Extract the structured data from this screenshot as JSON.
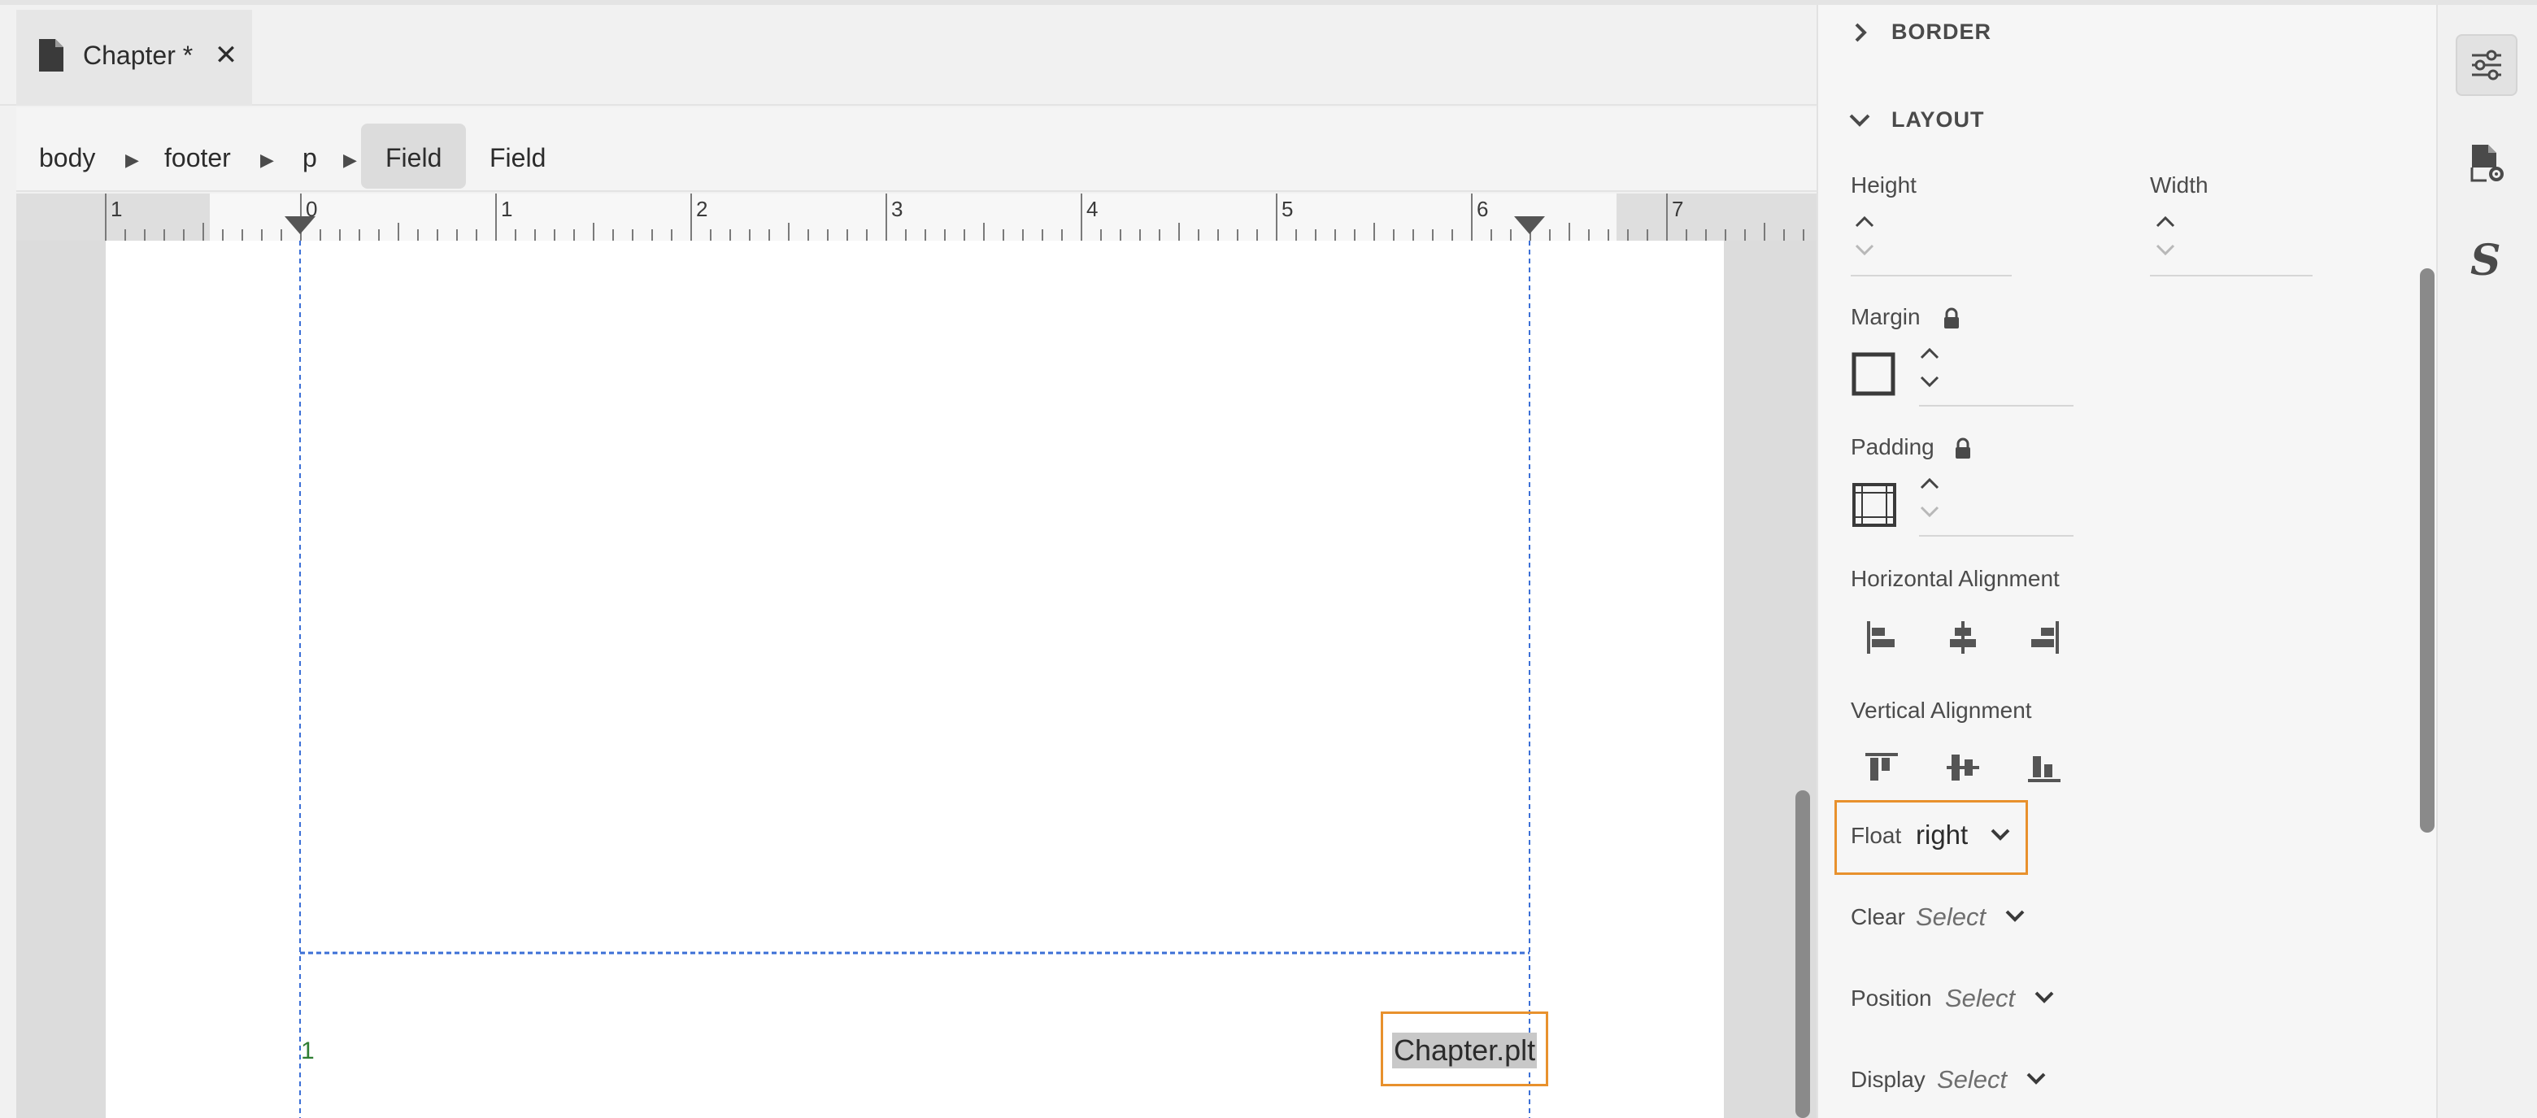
{
  "tab": {
    "title": "Chapter *",
    "close_glyph": "✕",
    "icon": "file-icon"
  },
  "breadcrumb": {
    "items": [
      "body",
      "footer",
      "p",
      "Field",
      "Field"
    ],
    "separator": "▶",
    "active_index": 3
  },
  "ruler": {
    "labels": [
      "1",
      "0",
      "1",
      "2",
      "3",
      "4",
      "5",
      "6",
      "7"
    ]
  },
  "document": {
    "page_number": "1",
    "field_text": "Chapter.plt"
  },
  "panel": {
    "border_section": "BORDER",
    "layout_section": "LAYOUT",
    "height_label": "Height",
    "width_label": "Width",
    "margin_label": "Margin",
    "padding_label": "Padding",
    "horizontal_alignment_label": "Horizontal Alignment",
    "vertical_alignment_label": "Vertical Alignment",
    "float_label": "Float",
    "float_value": "right",
    "clear_label": "Clear",
    "clear_placeholder": "Select",
    "position_label": "Position",
    "position_placeholder": "Select",
    "display_label": "Display",
    "display_placeholder": "Select"
  },
  "rail": {
    "items": [
      "sliders-icon",
      "document-settings-icon",
      "styles-icon"
    ],
    "styles_glyph": "S"
  },
  "colors": {
    "highlight": "#e8912d",
    "guide": "#3b6fd6",
    "page_number": "#2e7d32"
  }
}
